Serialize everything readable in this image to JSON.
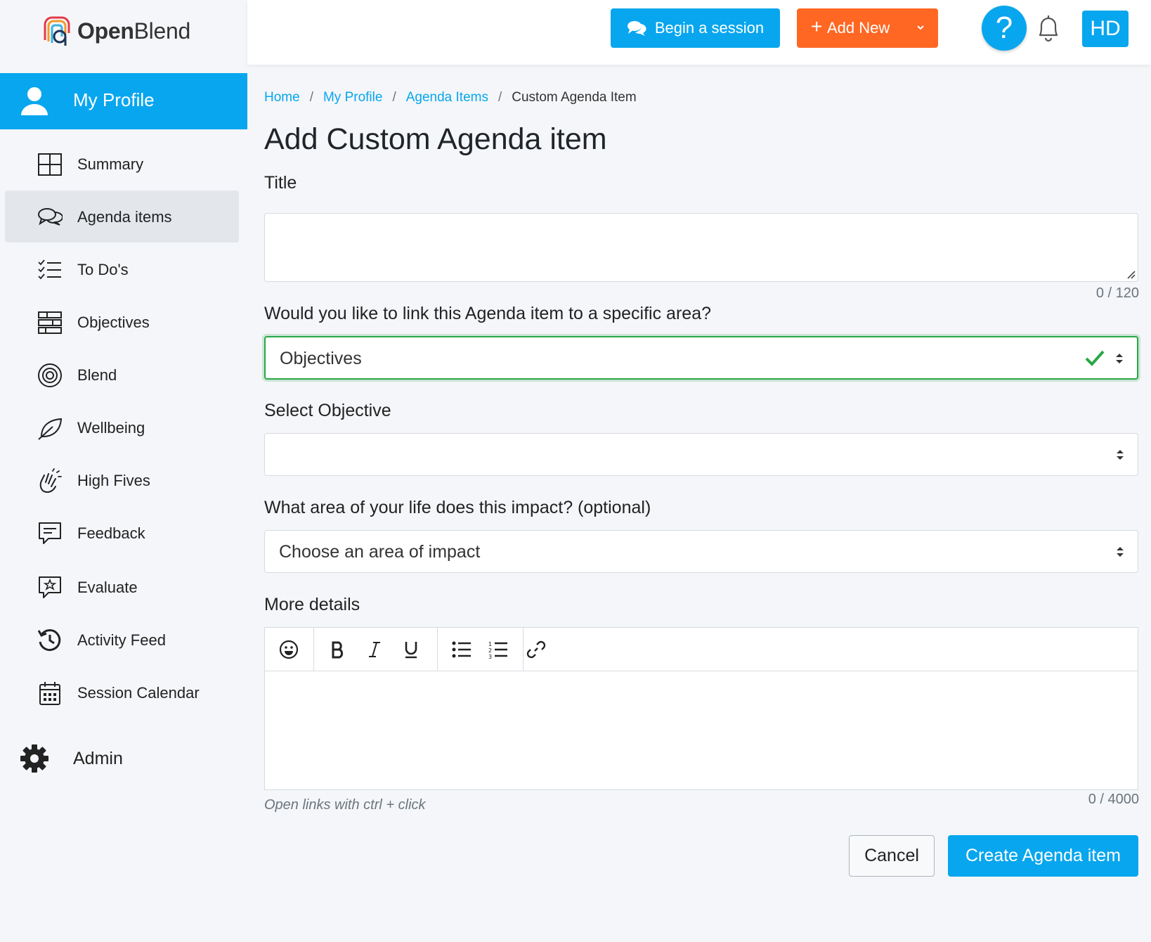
{
  "brand": {
    "name_bold": "Open",
    "name_light": "Blend"
  },
  "sidebar": {
    "profile_label": "My Profile",
    "items": [
      {
        "label": "Summary",
        "icon": "grid-icon"
      },
      {
        "label": "Agenda items",
        "icon": "chat-bubbles-icon",
        "active": true
      },
      {
        "label": "To Do's",
        "icon": "checklist-icon"
      },
      {
        "label": "Objectives",
        "icon": "stacked-bars-icon"
      },
      {
        "label": "Blend",
        "icon": "target-icon"
      },
      {
        "label": "Wellbeing",
        "icon": "leaf-icon"
      },
      {
        "label": "High Fives",
        "icon": "clapping-hands-icon"
      },
      {
        "label": "Feedback",
        "icon": "message-icon"
      },
      {
        "label": "Evaluate",
        "icon": "star-message-icon"
      },
      {
        "label": "Activity Feed",
        "icon": "history-icon"
      },
      {
        "label": "Session Calendar",
        "icon": "calendar-icon"
      }
    ],
    "admin_label": "Admin"
  },
  "topbar": {
    "begin_session": "Begin a session",
    "add_new": "Add New",
    "help": "?",
    "avatar_initials": "HD"
  },
  "breadcrumb": {
    "home": "Home",
    "my_profile": "My Profile",
    "agenda_items": "Agenda Items",
    "current": "Custom Agenda Item",
    "sep": "/"
  },
  "page": {
    "title": "Add Custom Agenda item",
    "title_label": "Title",
    "title_value": "",
    "title_counter": "0 / 120",
    "link_label": "Would you like to link this Agenda item to a specific area?",
    "link_value": "Objectives",
    "objective_label": "Select Objective",
    "objective_value": "",
    "impact_label": "What area of your life does this impact? (optional)",
    "impact_value": "Choose an area of impact",
    "details_label": "More details",
    "details_hint": "Open links with ctrl + click",
    "details_counter": "0 / 4000",
    "cancel": "Cancel",
    "create": "Create Agenda item"
  },
  "colors": {
    "accent": "#08a6ee",
    "orange": "#ff6723",
    "valid": "#28a745"
  }
}
